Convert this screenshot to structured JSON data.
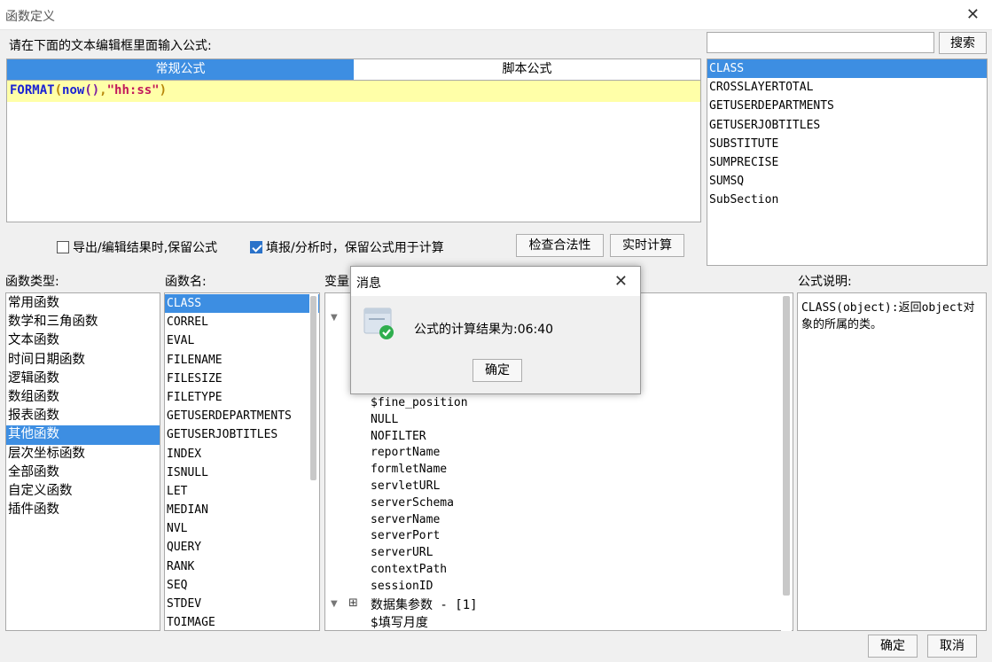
{
  "window": {
    "title": "函数定义"
  },
  "prompt_label": "请在下面的文本编辑框里面输入公式:",
  "tabs": {
    "regular": "常规公式",
    "script": "脚本公式"
  },
  "formula": {
    "fn": "FORMAT",
    "open": "(",
    "inner_fn": "now",
    "inner_parens": "()",
    "comma": ",",
    "str": "\"hh:ss\"",
    "close": ")"
  },
  "search": {
    "value": "",
    "button": "搜索"
  },
  "search_results": [
    "CLASS",
    "CROSSLAYERTOTAL",
    "GETUSERDEPARTMENTS",
    "GETUSERJOBTITLES",
    "SUBSTITUTE",
    "SUMPRECISE",
    "SUMSQ",
    "SubSection"
  ],
  "options": {
    "keep_on_export": "导出/编辑结果时,保留公式",
    "keep_on_fill": "填报/分析时，保留公式用于计算",
    "keep_on_export_checked": false,
    "keep_on_fill_checked": true
  },
  "buttons": {
    "check": "检查合法性",
    "realtime": "实时计算",
    "ok": "确定",
    "cancel": "取消"
  },
  "panels": {
    "types": "函数类型:",
    "names": "函数名:",
    "vars": "变量",
    "desc": "公式说明:"
  },
  "function_types": [
    "常用函数",
    "数学和三角函数",
    "文本函数",
    "时间日期函数",
    "逻辑函数",
    "数组函数",
    "报表函数",
    "其他函数",
    "层次坐标函数",
    "全部函数",
    "自定义函数",
    "插件函数"
  ],
  "function_names": [
    "CLASS",
    "CORREL",
    "EVAL",
    "FILENAME",
    "FILESIZE",
    "FILETYPE",
    "GETUSERDEPARTMENTS",
    "GETUSERJOBTITLES",
    "INDEX",
    "ISNULL",
    "LET",
    "MEDIAN",
    "NVL",
    "QUERY",
    "RANK",
    "SEQ",
    "STDEV",
    "TOIMAGE"
  ],
  "variables": [
    "$fine_position",
    "NULL",
    "NOFILTER",
    "reportName",
    "formletName",
    "servletURL",
    "serverSchema",
    "serverName",
    "serverPort",
    "serverURL",
    "contextPath",
    "sessionID"
  ],
  "dataset_node": "数据集参数 - [1]",
  "dataset_child": "$填写月度",
  "description": "CLASS(object):返回object对象的所属的类。",
  "message_dialog": {
    "title": "消息",
    "text": "公式的计算结果为:06:40",
    "ok": "确定"
  }
}
